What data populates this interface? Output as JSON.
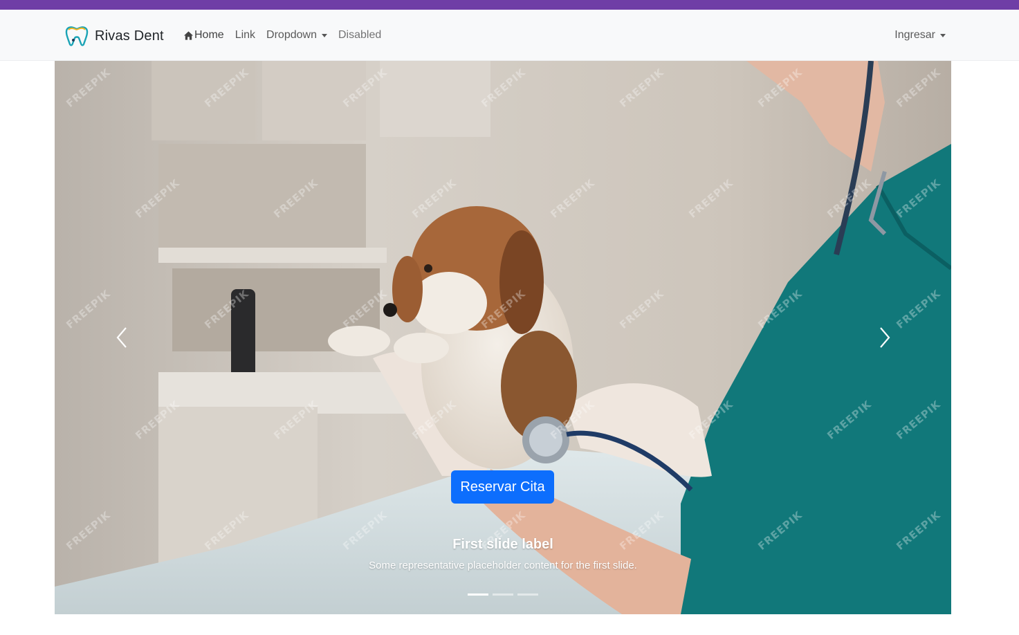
{
  "colors": {
    "browser_strip": "#6f3ea6",
    "navbar_bg": "#f8f9fa",
    "primary": "#0d6efd",
    "scrubs": "#11787a"
  },
  "navbar": {
    "brand": "Rivas Dent",
    "brand_logo_icon": "tooth-logo-icon",
    "links": [
      {
        "label": "Home",
        "icon": "home-icon",
        "active": true
      },
      {
        "label": "Link"
      },
      {
        "label": "Dropdown",
        "dropdown": true
      },
      {
        "label": "Disabled",
        "disabled": true
      }
    ],
    "login": "Ingresar"
  },
  "carousel": {
    "watermark": "FREEPIK",
    "cta": "Reservar Cita",
    "caption_title": "First slide label",
    "caption_text": "Some representative placeholder content for the first slide.",
    "slide_count": 3,
    "active_slide": 1,
    "prev_icon": "chevron-left-icon",
    "next_icon": "chevron-right-icon"
  }
}
